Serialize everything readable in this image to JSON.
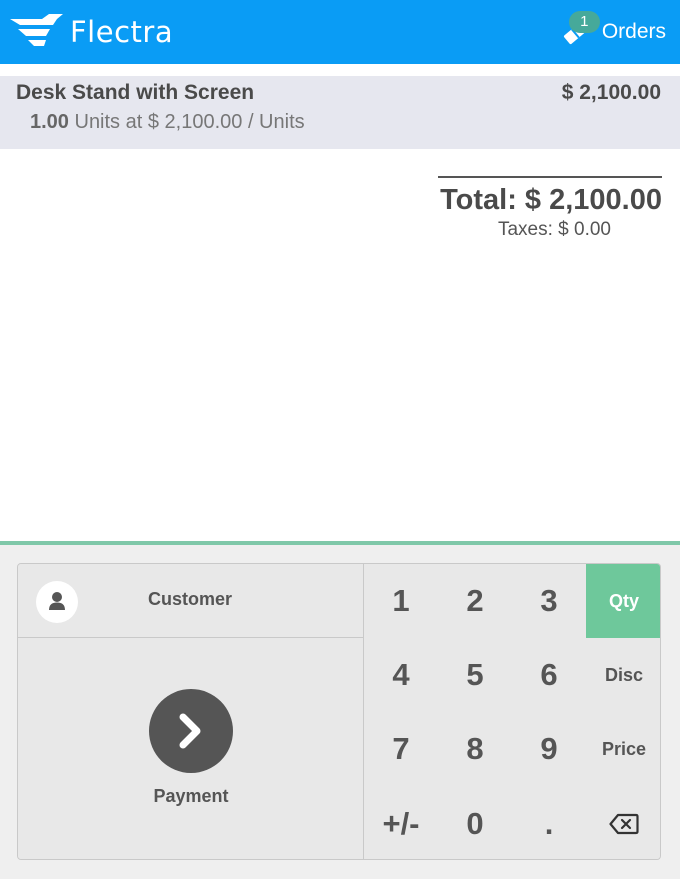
{
  "header": {
    "logo_text": "Flectra",
    "orders_count": "1",
    "orders_label": "Orders"
  },
  "orderline": {
    "product_name": "Desk Stand with Screen",
    "price": "$ 2,100.00",
    "quantity": "1.00",
    "unit_info": " Units at $ 2,100.00 / Units"
  },
  "summary": {
    "total": "Total: $ 2,100.00",
    "taxes": "Taxes: $ 0.00"
  },
  "actionpad": {
    "customer_label": "Customer",
    "payment_label": "Payment"
  },
  "numpad": {
    "keys": [
      "1",
      "2",
      "3",
      "4",
      "5",
      "6",
      "7",
      "8",
      "9",
      "+/-",
      "0",
      "."
    ],
    "modes": [
      "Qty",
      "Disc",
      "Price"
    ],
    "active_mode": "Qty"
  },
  "colors": {
    "header": "#0a9cf5",
    "active_mode": "#6ec89b",
    "badge": "#46a99a",
    "pads_border": "#7fc8a9"
  }
}
